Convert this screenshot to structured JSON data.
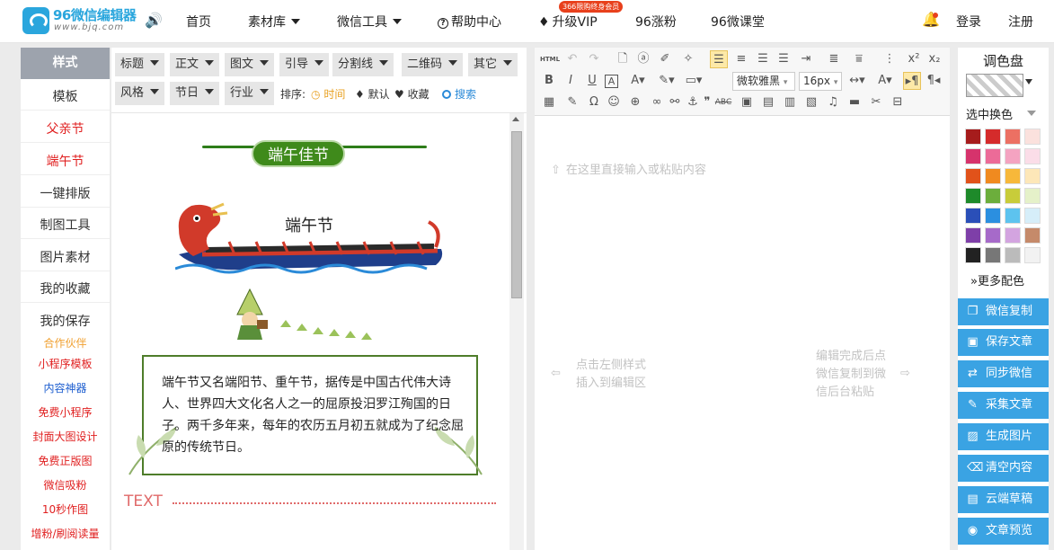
{
  "header": {
    "logo_title": "96微信编辑器",
    "logo_url": "www.bjq.com",
    "nav": [
      {
        "label": "首页",
        "caret": false
      },
      {
        "label": "素材库",
        "caret": true
      },
      {
        "label": "微信工具",
        "caret": true
      },
      {
        "label": "帮助中心",
        "caret": false
      },
      {
        "label": "升级VIP",
        "caret": false
      },
      {
        "label": "96涨粉",
        "caret": false
      },
      {
        "label": "96微课堂",
        "caret": false
      }
    ],
    "help_icon": "?",
    "vip_icon": "♦",
    "vip_badge": "366限购终身会员",
    "login": "登录",
    "register": "注册"
  },
  "sidebar": {
    "active_tab": "样式",
    "items": [
      "模板",
      "父亲节",
      "端午节",
      "一键排版",
      "制图工具",
      "图片素材",
      "我的收藏",
      "我的保存"
    ],
    "partner_label": "合作伙伴",
    "partners": [
      "小程序模板",
      "内容神器",
      "免费小程序",
      "封面大图设计",
      "免费正版图",
      "微信吸粉",
      "10秒作图",
      "增粉/刷阅读量"
    ]
  },
  "style_filter": {
    "row1": [
      "标题",
      "正文",
      "图文",
      "引导",
      "分割线",
      "二维码",
      "其它"
    ],
    "row2": [
      "风格",
      "节日",
      "行业"
    ],
    "sort_label": "排序:",
    "sort_options": [
      {
        "icon": "◷",
        "label": "时间"
      },
      {
        "icon": "♦",
        "label": "默认"
      },
      {
        "icon": "♥",
        "label": "收藏"
      }
    ],
    "search_label": "搜索"
  },
  "preview": {
    "heading": "端午佳节",
    "subheading": "端午节",
    "poem": "端午节又名端阳节、重午节，据传是中国古代伟大诗人、世界四大文化名人之一的屈原投汨罗江殉国的日子。两千多年来，每年的农历五月初五就成为了纪念屈原的传统节日。",
    "divider_label": "TEXT"
  },
  "editor": {
    "font_select": "微软雅黑",
    "size_select": "16px",
    "hint_top": "在这里直接输入或粘贴内容",
    "hint_left_1": "点击左侧样式",
    "hint_left_2": "插入到编辑区",
    "hint_right_1": "编辑完成后点",
    "hint_right_2": "微信复制到微",
    "hint_right_3": "信后台粘贴"
  },
  "palette": {
    "title": "调色盘",
    "pick_label": "选中换色",
    "more_label": "更多配色",
    "colors": [
      "#a61c1c",
      "#d52b2b",
      "#ec7063",
      "#fbe1dd",
      "#d6336c",
      "#ec6b98",
      "#f4a3c1",
      "#fbdde8",
      "#e1521a",
      "#f08a1f",
      "#f7b83a",
      "#fde7b8",
      "#1e8a2a",
      "#6cae3c",
      "#c8cc3a",
      "#e5f1c9",
      "#2a4fb8",
      "#2b8fe0",
      "#5dc3ef",
      "#d6eef9",
      "#7e3fa8",
      "#a66ac9",
      "#d3a4e0",
      "#c58a6a",
      "#222222",
      "#777777",
      "#bbbbbb",
      "#f2f2f2"
    ]
  },
  "actions": [
    {
      "icon": "❐",
      "label": "微信复制"
    },
    {
      "icon": "▣",
      "label": "保存文章"
    },
    {
      "icon": "⇄",
      "label": "同步微信"
    },
    {
      "icon": "✎",
      "label": "采集文章"
    },
    {
      "icon": "▨",
      "label": "生成图片"
    },
    {
      "icon": "⌫",
      "label": "清空内容"
    },
    {
      "icon": "▤",
      "label": "云端草稿"
    },
    {
      "icon": "◉",
      "label": "文章预览"
    }
  ]
}
